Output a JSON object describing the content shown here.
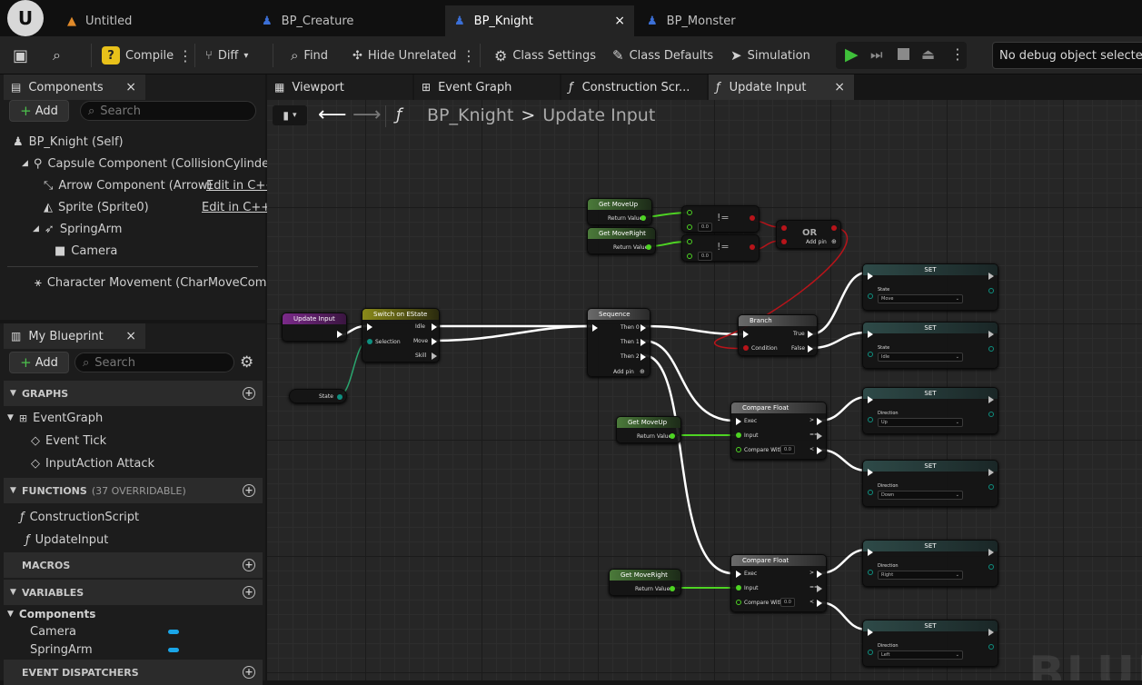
{
  "tabs": [
    {
      "label": "Untitled"
    },
    {
      "label": "BP_Creature"
    },
    {
      "label": "BP_Knight",
      "close": "×"
    },
    {
      "label": "BP_Monster"
    }
  ],
  "toolbar": {
    "compile": "Compile",
    "diff": "Diff",
    "find": "Find",
    "hide_unrelated": "Hide Unrelated",
    "class_settings": "Class Settings",
    "class_defaults": "Class Defaults",
    "simulation": "Simulation",
    "debug_object": "No debug object selected"
  },
  "components": {
    "title": "Components",
    "close": "×",
    "add": "Add",
    "search_placeholder": "Search",
    "items": [
      {
        "label": "BP_Knight (Self)"
      },
      {
        "label": "Capsule Component (CollisionCylinder)"
      },
      {
        "label": "Arrow Component (Arrow)",
        "edit": "Edit in C++"
      },
      {
        "label": "Sprite (Sprite0)",
        "edit": "Edit in C++"
      },
      {
        "label": "SpringArm"
      },
      {
        "label": "Camera"
      },
      {
        "label": "Character Movement (CharMoveComp)"
      }
    ]
  },
  "my_blueprint": {
    "title": "My Blueprint",
    "close": "×",
    "add": "Add",
    "search_placeholder": "Search",
    "graphs_header": "GRAPHS",
    "event_graph": "EventGraph",
    "events": [
      "Event Tick",
      "InputAction Attack"
    ],
    "functions_header": "FUNCTIONS",
    "functions_note": "(37 OVERRIDABLE)",
    "functions": [
      "ConstructionScript",
      "UpdateInput"
    ],
    "macros_header": "MACROS",
    "variables_header": "VARIABLES",
    "var_category": "Components",
    "variables": [
      "Camera",
      "SpringArm"
    ],
    "dispatchers_header": "EVENT DISPATCHERS"
  },
  "editor_tabs": [
    "Viewport",
    "Event Graph",
    "Construction Scr...",
    "Update Input"
  ],
  "editor_tab_close": "×",
  "breadcrumb": {
    "blueprint": "BP_Knight",
    "sep": ">",
    "function": "Update Input"
  },
  "watermark": "BLUE",
  "nodes": {
    "update_input": "Update Input",
    "switch": "Switch on EState",
    "switch_pins": [
      "Idle",
      "Move",
      "Skill"
    ],
    "selection": "Selection",
    "state_var": "State",
    "sequence": "Sequence",
    "sequence_pins": [
      "Then 0",
      "Then 1",
      "Then 2"
    ],
    "add_pin": "Add pin",
    "get_move_up": "Get MoveUp",
    "get_move_right": "Get MoveRight",
    "return_value": "Return Value",
    "zero": "0.0",
    "not_equal": "!=",
    "or": "OR",
    "branch": "Branch",
    "true": "True",
    "false": "False",
    "condition": "Condition",
    "compare_float": "Compare Float",
    "exec": "Exec",
    "input": "Input",
    "compare_with": "Compare With",
    "set": "SET",
    "state_label": "State",
    "direction_label": "Direction",
    "set_values": [
      "Move",
      "Idle",
      "Up",
      "Down",
      "Right",
      "Left"
    ]
  }
}
